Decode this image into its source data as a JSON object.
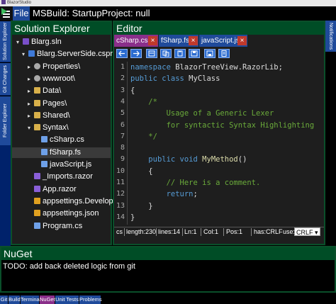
{
  "window": {
    "title": "BlazorStudio"
  },
  "topbar": {
    "file_label": "File",
    "msbuild_label": "MSBuild: StartupProject: null"
  },
  "left_rail": {
    "tabs": [
      "Solution Explorer",
      "Git Changes",
      "Folder Explorer"
    ]
  },
  "right_rail": {
    "tabs": [
      "Notifications"
    ]
  },
  "solution_explorer": {
    "title": "Solution Explorer",
    "nodes": [
      {
        "label": "Blarg.sln",
        "caret": "v",
        "icon": "solution-icon",
        "selected": false
      },
      {
        "label": "Blarg.ServerSide.csproj",
        "caret": "v",
        "icon": "csproj-icon",
        "selected": false
      },
      {
        "label": "Properties\\",
        "caret": ">",
        "icon": "gear-icon",
        "selected": false
      },
      {
        "label": "wwwroot\\",
        "caret": ">",
        "icon": "globe-icon",
        "selected": false
      },
      {
        "label": "Data\\",
        "caret": ">",
        "icon": "folder-icon",
        "selected": false
      },
      {
        "label": "Pages\\",
        "caret": ">",
        "icon": "folder-icon",
        "selected": false
      },
      {
        "label": "Shared\\",
        "caret": ">",
        "icon": "folder-icon",
        "selected": false
      },
      {
        "label": "Syntax\\",
        "caret": "v",
        "icon": "folder-icon",
        "selected": false
      },
      {
        "label": "cSharp.cs",
        "caret": "",
        "icon": "file-icon",
        "selected": false
      },
      {
        "label": "fSharp.fs",
        "caret": "",
        "icon": "file-icon",
        "selected": true
      },
      {
        "label": "javaScript.js",
        "caret": "",
        "icon": "file-icon",
        "selected": false
      },
      {
        "label": "_Imports.razor",
        "caret": "",
        "icon": "razor-icon",
        "selected": false
      },
      {
        "label": "App.razor",
        "caret": "",
        "icon": "razor-icon",
        "selected": false
      },
      {
        "label": "appsettings.Developme",
        "caret": "",
        "icon": "json-icon",
        "selected": false
      },
      {
        "label": "appsettings.json",
        "caret": "",
        "icon": "json-icon",
        "selected": false
      },
      {
        "label": "Program.cs",
        "caret": "",
        "icon": "file-icon",
        "selected": false
      }
    ]
  },
  "editor": {
    "title": "Editor",
    "tabs": [
      {
        "label": "cSharp.cs",
        "active": true
      },
      {
        "label": "fSharp.fs",
        "active": false
      },
      {
        "label": "javaScript.js",
        "active": false
      }
    ],
    "toolbar_icons": [
      "arrow-left-icon",
      "arrow-right-icon",
      "settings-icon",
      "copy-icon",
      "paste-icon",
      "save-icon",
      "save-all-icon",
      "document-icon"
    ],
    "lines": [
      {
        "n": "1",
        "segs": [
          [
            "kw",
            "namespace"
          ],
          [
            "",
            " BlazorTreeView.RazorLib;"
          ]
        ]
      },
      {
        "n": "2",
        "segs": [
          [
            "kw",
            "public class"
          ],
          [
            "",
            " MyClass"
          ]
        ]
      },
      {
        "n": "3",
        "segs": [
          [
            "",
            "{"
          ]
        ]
      },
      {
        "n": "4",
        "segs": [
          [
            "cm",
            "    /*"
          ]
        ]
      },
      {
        "n": "5",
        "segs": [
          [
            "cm",
            "        Usage of a Generic Lexer"
          ]
        ]
      },
      {
        "n": "6",
        "segs": [
          [
            "cm",
            "        for syntactic Syntax Highlighting"
          ]
        ]
      },
      {
        "n": "7",
        "segs": [
          [
            "cm",
            "    */"
          ]
        ]
      },
      {
        "n": "8",
        "segs": [
          [
            "",
            ""
          ]
        ]
      },
      {
        "n": "9",
        "segs": [
          [
            "",
            "    "
          ],
          [
            "kw",
            "public void"
          ],
          [
            "",
            " "
          ],
          [
            "fn",
            "MyMethod"
          ],
          [
            "",
            "()"
          ]
        ]
      },
      {
        "n": "10",
        "segs": [
          [
            "",
            "    {"
          ]
        ]
      },
      {
        "n": "11",
        "segs": [
          [
            "cm",
            "        // Here is a comment."
          ]
        ]
      },
      {
        "n": "12",
        "segs": [
          [
            "",
            "        "
          ],
          [
            "kw",
            "return"
          ],
          [
            "",
            ";"
          ]
        ]
      },
      {
        "n": "13",
        "segs": [
          [
            "",
            "    }"
          ]
        ]
      },
      {
        "n": "14",
        "segs": [
          [
            "",
            "}"
          ]
        ]
      }
    ],
    "status": {
      "lang": "cs",
      "length": "length:230",
      "lines": "lines:14",
      "ln": "Ln:1",
      "col": "Col:1",
      "pos": "Pos:1",
      "crlf": "has:CRLF",
      "use": "use:",
      "line_ending": "CRLF"
    }
  },
  "nuget": {
    "title": "NuGet",
    "text": "TODO: add back deleted logic from git"
  },
  "bottom_tabs": [
    {
      "label": "Git",
      "active": false
    },
    {
      "label": "Build",
      "active": false
    },
    {
      "label": "Terminal",
      "active": false
    },
    {
      "label": "NuGet",
      "active": true
    },
    {
      "label": "Unit Tests",
      "active": false
    },
    {
      "label": "Problems",
      "active": false
    }
  ],
  "colors": {
    "accent": "#1f4a9a",
    "panel_header": "#004d26",
    "active_tab": "#8a2f8a",
    "close": "#c0392b"
  }
}
